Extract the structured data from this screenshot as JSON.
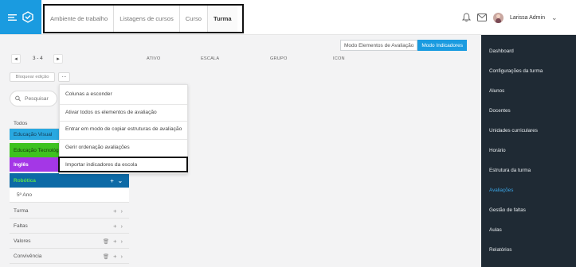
{
  "header": {
    "tabs": [
      "Ambiente de trabalho",
      "Listagens de cursos",
      "Curso",
      "Turma"
    ],
    "user_name": "Larissa Admin",
    "user_caret": "⌄"
  },
  "modes": {
    "elements": "Modo Elementos de Avaliação",
    "indicators": "Modo Indicadores"
  },
  "pager": {
    "prev": "◂",
    "next": "▸",
    "range": "3 - 4"
  },
  "columns": [
    "ATIVO",
    "ESCALA",
    "GRUPO",
    "ICON"
  ],
  "toolbar": {
    "lock_label": "Bloquear edição",
    "more_label": "..."
  },
  "search": {
    "placeholder": "Pesquisar"
  },
  "dropdown": {
    "items": [
      "Colunas a esconder",
      "Ativar todos os elementos de avaliação",
      "Entrar em modo de copiar estruturas de avaliação",
      "Gerir ordenação avaliações",
      "Importar indicadores da escola"
    ]
  },
  "list": {
    "todos": "Todos",
    "subjects": [
      {
        "label": "Educação Visual",
        "color": "#29a8e0"
      },
      {
        "label": "Educação Tecnológica",
        "color": "#3ec21f"
      },
      {
        "label": "Inglês",
        "color": "#a437e6"
      },
      {
        "label": "Robótica",
        "color": "#0d6aa6"
      }
    ],
    "plus": "+",
    "chevron_down": "⌄",
    "chevron_right": "›",
    "trash": "🗑",
    "year": "5º Ano",
    "sections": [
      "Turma",
      "Faltas",
      "Valores",
      "Convivência"
    ]
  },
  "sidebar": {
    "items": [
      "Dashboard",
      "Configurações da turma",
      "Alunos",
      "Docentes",
      "Unidades curriculares",
      "Horário",
      "Estrutura da turma",
      "Avaliações",
      "Gestão de faltas",
      "Aulas",
      "Relatórios"
    ],
    "active_index": 7
  },
  "colors": {
    "brand_blue": "#1a9be0",
    "sidebar_bg": "#1f2a34",
    "active_link": "#3aa7e8"
  }
}
